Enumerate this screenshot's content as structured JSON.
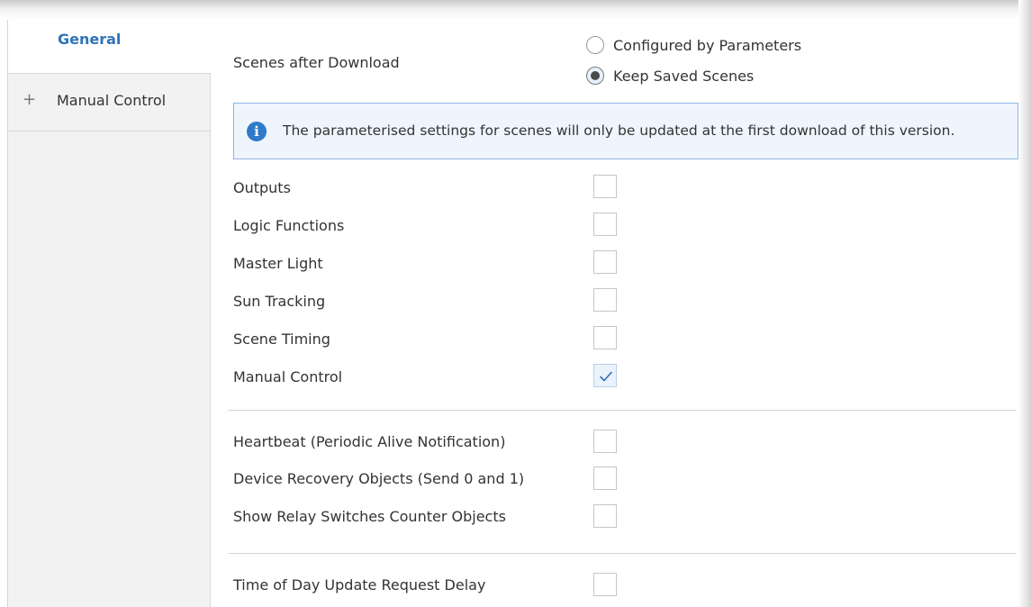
{
  "sidebar": {
    "items": [
      {
        "label": "General",
        "active": true
      },
      {
        "label": "Manual Control",
        "expand": "+"
      }
    ]
  },
  "scenes": {
    "label": "Scenes after Download",
    "options": [
      {
        "label": "Configured by Parameters",
        "selected": false
      },
      {
        "label": "Keep Saved Scenes",
        "selected": true
      }
    ]
  },
  "info": {
    "icon": "info-icon",
    "text": "The parameterised settings for scenes will only be updated at the first download of this version."
  },
  "group1": [
    {
      "label": "Outputs",
      "checked": false
    },
    {
      "label": "Logic Functions",
      "checked": false
    },
    {
      "label": "Master Light",
      "checked": false
    },
    {
      "label": "Sun Tracking",
      "checked": false
    },
    {
      "label": "Scene Timing",
      "checked": false
    },
    {
      "label": "Manual Control",
      "checked": true
    }
  ],
  "group2": [
    {
      "label": "Heartbeat (Periodic Alive Notification)",
      "checked": false
    },
    {
      "label": "Device Recovery Objects (Send 0 and 1)",
      "checked": false
    },
    {
      "label": "Show Relay Switches Counter Objects",
      "checked": false
    }
  ],
  "group3": [
    {
      "label": "Time of Day Update Request Delay",
      "checked": false
    }
  ],
  "colors": {
    "accent": "#2f73b9",
    "info_bg": "#eef5fd",
    "info_border": "#8fb6e0"
  }
}
